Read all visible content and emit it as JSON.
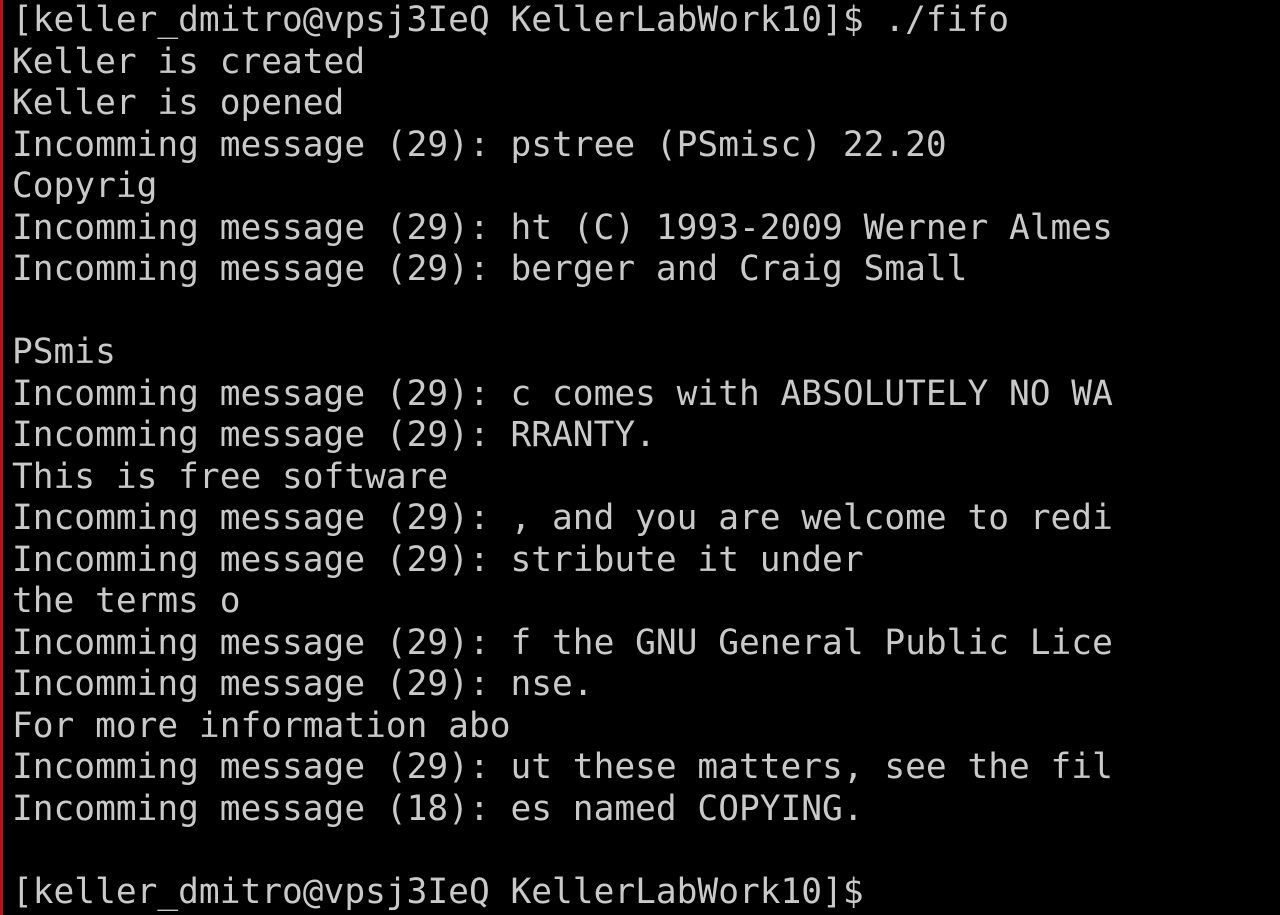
{
  "colors": {
    "background": "#000000",
    "foreground": "#c9c9c9",
    "left_edge": "#b3141c"
  },
  "terminal": {
    "lines": [
      "[keller_dmitro@vpsj3IeQ KellerLabWork10]$ ./fifo",
      "Keller is created",
      "Keller is opened",
      "Incomming message (29): pstree (PSmisc) 22.20",
      "Copyrig",
      "Incomming message (29): ht (C) 1993-2009 Werner Almes",
      "Incomming message (29): berger and Craig Small",
      "",
      "PSmis",
      "Incomming message (29): c comes with ABSOLUTELY NO WA",
      "Incomming message (29): RRANTY.",
      "This is free software",
      "Incomming message (29): , and you are welcome to redi",
      "Incomming message (29): stribute it under",
      "the terms o",
      "Incomming message (29): f the GNU General Public Lice",
      "Incomming message (29): nse.",
      "For more information abo",
      "Incomming message (29): ut these matters, see the fil",
      "Incomming message (18): es named COPYING.",
      "",
      "[keller_dmitro@vpsj3IeQ KellerLabWork10]$"
    ]
  }
}
